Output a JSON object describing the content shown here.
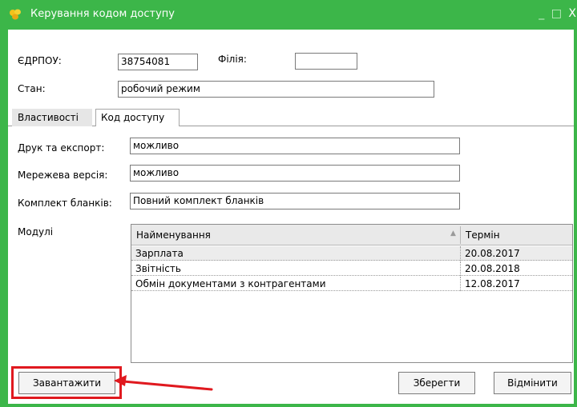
{
  "window": {
    "title": "Керування кодом доступу",
    "controls": [
      "_",
      "□",
      "X"
    ]
  },
  "header": {
    "edrpou_label": "ЄДРПОУ:",
    "edrpou_value": "38754081",
    "filiya_label": "Філія:",
    "filiya_value": "",
    "stan_label": "Стан:",
    "stan_value": "робочий режим"
  },
  "tabs": [
    {
      "label": "Властивості",
      "active": true
    },
    {
      "label": "Код доступу",
      "active": false
    }
  ],
  "properties": {
    "druk_label": "Друк та експорт:",
    "druk_value": "можливо",
    "merezheva_label": "Мережева версія:",
    "merezheva_value": "можливо",
    "komplekt_label": "Комплект бланків:",
    "komplekt_value": "Повний комплект бланків",
    "moduli_label": "Модулі"
  },
  "modules_table": {
    "columns": [
      "Найменування",
      "Термін"
    ],
    "sort_indicator": "▲",
    "rows": [
      {
        "name": "Зарплата",
        "term": "20.08.2017"
      },
      {
        "name": "Звітність",
        "term": "20.08.2018"
      },
      {
        "name": "Обмін документами з контрагентами",
        "term": "12.08.2017"
      }
    ]
  },
  "buttons": {
    "load_label": "Завантажити",
    "save_label": "Зберегти",
    "cancel_label": "Відмінити"
  },
  "colors": {
    "titlebar": "#3cb649",
    "highlight": "#e0191f"
  }
}
